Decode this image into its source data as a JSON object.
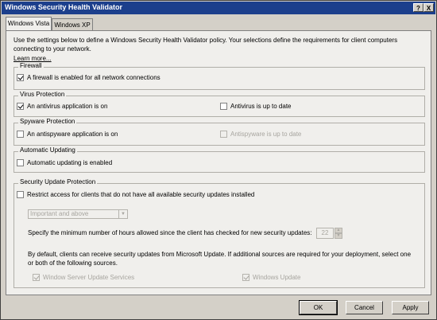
{
  "window": {
    "title": "Windows Security Health Validator",
    "help_glyph": "?",
    "close_glyph": "X"
  },
  "tabs": [
    {
      "label": "Windows Vista"
    },
    {
      "label": "Windows XP"
    }
  ],
  "intro": "Use the settings below to define a Windows Security Health Validator policy. Your selections define the requirements for client computers connecting to your network.",
  "learn_more": "Learn more...",
  "firewall": {
    "title": "Firewall",
    "check_label": "A firewall is enabled for all network connections",
    "checked": true
  },
  "virus": {
    "title": "Virus Protection",
    "on_label": "An antivirus application is on",
    "on_checked": true,
    "uptodate_label": "Antivirus is up to date",
    "uptodate_checked": false
  },
  "spyware": {
    "title": "Spyware Protection",
    "on_label": "An antispyware application is on",
    "on_checked": false,
    "uptodate_label": "Antispyware is up to date",
    "uptodate_checked": false
  },
  "updating": {
    "title": "Automatic Updating",
    "check_label": "Automatic updating is enabled",
    "checked": false
  },
  "security_updates": {
    "title": "Security Update Protection",
    "restrict_label": "Restrict access for clients that do not have all available security updates installed",
    "restrict_checked": false,
    "severity_selected": "Important and above",
    "hours_label": "Specify the minimum number of hours allowed since the client has checked for new security updates:",
    "hours_value": "22",
    "sources_text": "By default, clients can receive security updates from Microsoft Update.  If additional sources are required for your deployment, select one or both of the following sources.",
    "wsus_label": "Window Server Update Services",
    "wsus_checked": true,
    "windows_update_label": "Windows Update",
    "windows_update_checked": true
  },
  "buttons": {
    "ok": "OK",
    "cancel": "Cancel",
    "apply": "Apply"
  },
  "colors": {
    "titlebar": "#1c3f8c",
    "dialog": "#d4d0c8",
    "panel": "#f0efec"
  }
}
